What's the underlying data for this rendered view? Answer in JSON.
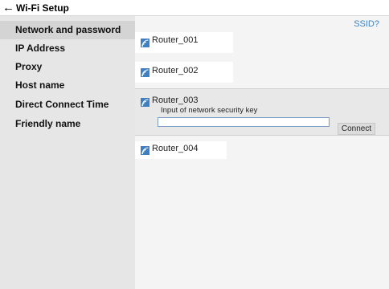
{
  "header": {
    "title": "Wi-Fi Setup",
    "back_icon": "back-arrow-icon"
  },
  "sidebar": {
    "items": [
      {
        "label": "Network and password",
        "selected": true
      },
      {
        "label": "IP Address",
        "selected": false
      },
      {
        "label": "Proxy",
        "selected": false
      },
      {
        "label": "Host name",
        "selected": false
      },
      {
        "label": "Direct Connect Time",
        "selected": false
      },
      {
        "label": "Friendly name",
        "selected": false
      }
    ]
  },
  "main": {
    "ssid_link": "SSID?",
    "network_icon": "wifi-signal-icon",
    "networks": [
      {
        "name": "Router_001"
      },
      {
        "name": "Router_002"
      },
      {
        "name": "Router_003",
        "expanded": true,
        "key_label": "Input of network security key",
        "key_value": "",
        "connect_label": "Connect"
      },
      {
        "name": "Router_004"
      }
    ]
  },
  "colors": {
    "accent": "#3a86c4",
    "sidebar_bg": "#e6e6e6",
    "sidebar_selected": "#d4d4d4",
    "content_bg": "#f4f4f4",
    "card_bg": "#ffffff",
    "expanded_bg": "#e8e8e8"
  }
}
